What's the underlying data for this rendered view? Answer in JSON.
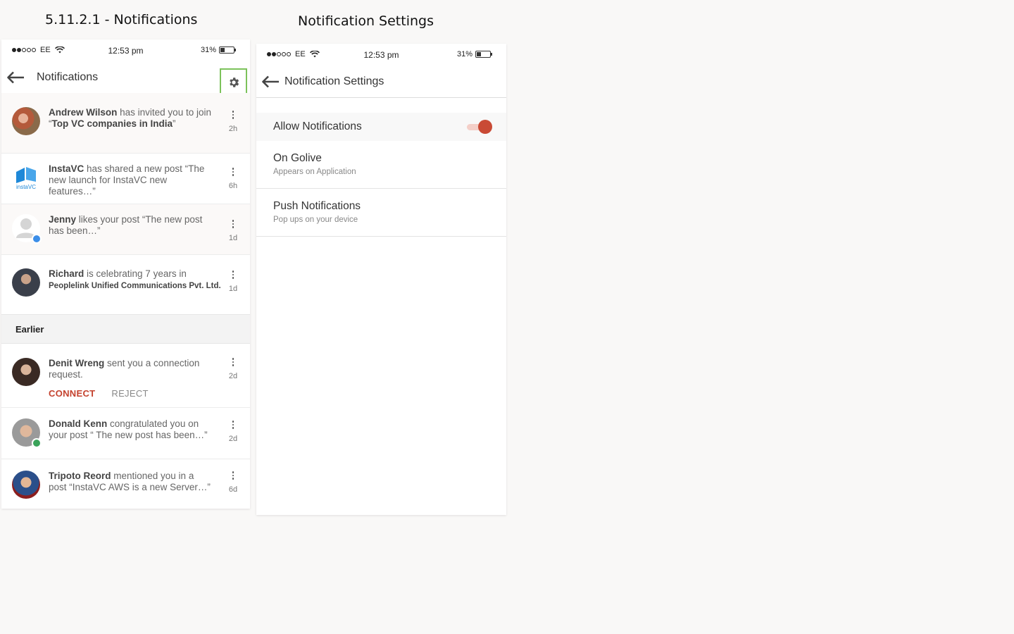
{
  "board": {
    "left_title": "5.11.2.1 - Notifications",
    "right_title": "Notification Settings"
  },
  "status_bar": {
    "carrier": "EE",
    "time": "12:53 pm",
    "battery": "31%",
    "battery_level": 0.31,
    "signal_bars_filled": 2,
    "signal_bars_total": 5
  },
  "notifications_screen": {
    "title": "Notifications",
    "settings_icon": "gear-icon",
    "items": [
      {
        "name": "Andrew Wilson",
        "pre": " has invited you to join “",
        "bold2": "Top VC companies in India",
        "post": "”",
        "time": "2h"
      },
      {
        "name": "InstaVC",
        "pre": " has shared a new post “The new launch for InstaVC new features…”",
        "time": "6h",
        "logo_text": "instaVC"
      },
      {
        "name": "Jenny",
        "pre": " likes your post “The new post has been…”",
        "time": "1d"
      },
      {
        "name": "Richard",
        "pre": " is celebrating 7 years in",
        "bold2": "Peoplelink Unified Communications Pvt. Ltd.",
        "time": "1d"
      }
    ],
    "earlier_label": "Earlier",
    "earlier_items": [
      {
        "name": "Denit Wreng",
        "pre": " sent you a connection request.",
        "time": "2d",
        "connect_label": "CONNECT",
        "reject_label": "REJECT"
      },
      {
        "name": "Donald Kenn",
        "pre": " congratulated you on your post “ The new post has been…”",
        "time": "2d"
      },
      {
        "name": "Tripoto Reord",
        "pre": " mentioned you in a post “InstaVC AWS is a new Server…”",
        "time": "6d"
      }
    ]
  },
  "settings_screen": {
    "title": "Notification Settings",
    "allow_label": "Allow Notifications",
    "allow_enabled": true,
    "rows": [
      {
        "title": "On Golive",
        "subtitle": "Appears on Application"
      },
      {
        "title": "Push Notifications",
        "subtitle": "Pop ups on your device"
      }
    ]
  },
  "colors": {
    "accent": "#c94a35",
    "highlight_box": "#7cc25b",
    "like_badge": "#3b8ee8",
    "congrats_badge": "#3aa35a"
  }
}
